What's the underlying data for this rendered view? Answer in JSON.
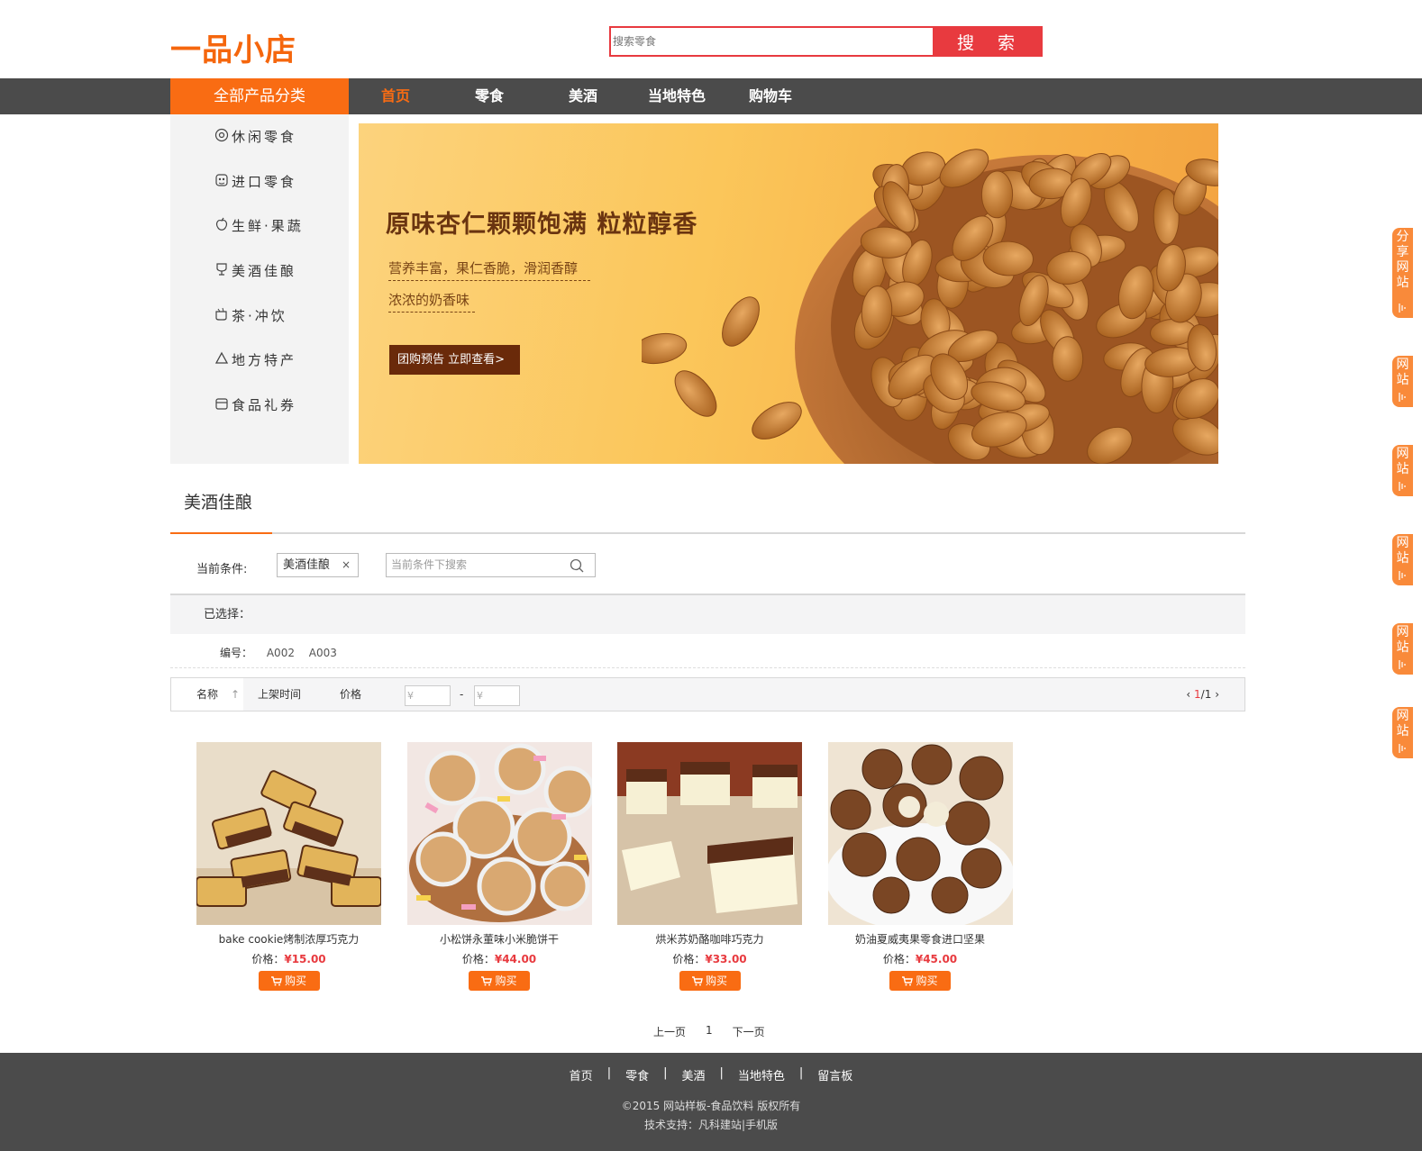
{
  "header": {
    "logo": "一品小店",
    "search_placeholder": "搜索零食",
    "search_button": "搜 索"
  },
  "nav": {
    "all_categories": "全部产品分类",
    "items": [
      "首页",
      "零食",
      "美酒",
      "当地特色",
      "购物车"
    ],
    "active": "首页"
  },
  "sidebar": {
    "items": [
      {
        "label": "休闲零食",
        "icon": "snack-icon"
      },
      {
        "label": "进口零食",
        "icon": "import-icon"
      },
      {
        "label": "生鲜·果蔬",
        "icon": "fruit-icon"
      },
      {
        "label": "美酒佳酿",
        "icon": "wine-icon"
      },
      {
        "label": "茶·冲饮",
        "icon": "tea-icon"
      },
      {
        "label": "地方特产",
        "icon": "specialty-icon"
      },
      {
        "label": "食品礼券",
        "icon": "voucher-icon"
      }
    ]
  },
  "banner": {
    "title": "原味杏仁颗颗饱满 粒粒醇香",
    "line1": "营养丰富，果仁香脆，滑润香醇",
    "line2": "浓浓的奶香味",
    "button": "团购预告 立即查看>"
  },
  "section": {
    "title": "美酒佳酿",
    "condition_label": "当前条件:",
    "condition_tag": "美酒佳酿",
    "condition_tag_close": "×",
    "condition_search_placeholder": "当前条件下搜索",
    "selected_label": "已选择：",
    "code_label": "编号：",
    "codes": [
      "A002",
      "A003"
    ]
  },
  "sort": {
    "name": "名称",
    "name_arrow": "↑",
    "time": "上架时间",
    "price": "价格",
    "price_min_placeholder": "¥",
    "price_max_placeholder": "¥",
    "price_dash": "-",
    "page_prev": "‹",
    "page_current": "1",
    "page_total": "/1",
    "page_next": "›"
  },
  "products": [
    {
      "name": "bake cookie烤制浓厚巧克力",
      "price_label": "价格：",
      "price": "¥15.00",
      "buy": "购买"
    },
    {
      "name": "小松饼永董味小米脆饼干",
      "price_label": "价格：",
      "price": "¥44.00",
      "buy": "购买"
    },
    {
      "name": "烘米苏奶酪咖啡巧克力",
      "price_label": "价格：",
      "price": "¥33.00",
      "buy": "购买"
    },
    {
      "name": "奶油夏威夷果零食进口坚果",
      "price_label": "价格：",
      "price": "¥45.00",
      "buy": "购买"
    }
  ],
  "pagination": {
    "prev": "上一页",
    "current": "1",
    "next": "下一页"
  },
  "footer": {
    "links": [
      "首页",
      "零食",
      "美酒",
      "当地特色",
      "留言板"
    ],
    "separator": "|",
    "copyright": "©2015 网站样板-食品饮料 版权所有",
    "tech": "技术支持：凡科建站|手机版"
  },
  "share_tabs": [
    "分享网站",
    "网站",
    "网站",
    "网站",
    "网站",
    "网站"
  ],
  "colors": {
    "brand_orange": "#f96c13",
    "search_red": "#e83a3f",
    "nav_dark": "#4b4b4b"
  }
}
